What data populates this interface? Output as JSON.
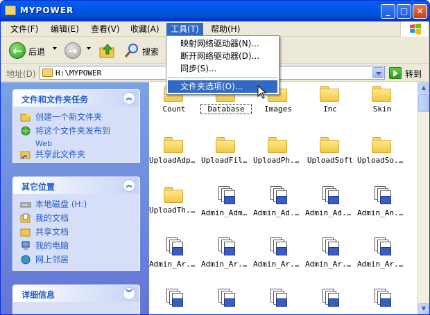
{
  "window": {
    "title": "MYPOWER",
    "min": "_",
    "max": "□",
    "close": "✕"
  },
  "menu": [
    "文件(F)",
    "编辑(E)",
    "查看(V)",
    "收藏(A)",
    "工具(T)",
    "帮助(H)"
  ],
  "toolbar": {
    "back_label": "后退",
    "search_label": "搜索"
  },
  "address": {
    "label": "地址(D)",
    "path": "H:\\MYPOWER",
    "go_label": "转到"
  },
  "tools_menu": {
    "items": [
      "映射网络驱动器(N)...",
      "断开网络驱动器(D)...",
      "同步(S)...",
      "文件夹选项(O)..."
    ]
  },
  "sidebar": {
    "tasks": {
      "title": "文件和文件夹任务",
      "items": [
        "创建一个新文件夹",
        "将这个文件夹发布到",
        "Web",
        "共享此文件夹"
      ]
    },
    "places": {
      "title": "其它位置",
      "items": [
        "本地磁盘 (H:)",
        "我的文档",
        "共享文档",
        "我的电脑",
        "网上邻居"
      ]
    },
    "details": {
      "title": "详细信息"
    }
  },
  "files": [
    "Count",
    "Database",
    "Images",
    "Inc",
    "Skin",
    "UploadAdpic",
    "UploadFiles",
    "UploadPh...",
    "UploadSoft",
    "UploadSo...",
    "UploadTh...",
    "Admin_Admin",
    "Admin_Ad...",
    "Admin_Ad...",
    "Admin_An...",
    "Admin_Ar...",
    "Admin_Ar...",
    "Admin_Ar...",
    "Admin_Ar...",
    "Admin_Ar...",
    "",
    "",
    "",
    "",
    ""
  ],
  "colors": {
    "titlebar": "#0058ee",
    "selection": "#316ac5",
    "sidebar_link": "#215dc6"
  }
}
